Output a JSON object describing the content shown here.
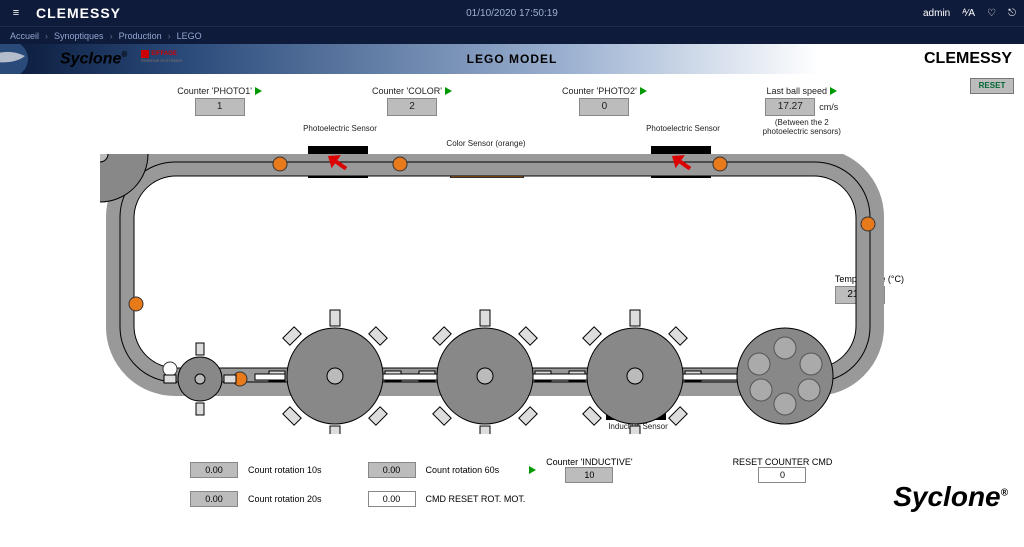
{
  "topbar": {
    "brand": "CLEMESSY",
    "datetime": "01/10/2020 17:50:19",
    "user": "admin"
  },
  "breadcrumbs": [
    "Accueil",
    "Synoptiques",
    "Production",
    "LEGO"
  ],
  "header": {
    "syclone": "Syclone",
    "eiffage": "EIFFAGE",
    "eiffage_sub": "ÉNERGIE SYSTÈMES",
    "title": "LEGO  MODEL",
    "brandright": "CLEMESSY",
    "reset": "RESET"
  },
  "counters": {
    "photo1": {
      "label": "Counter 'PHOTO1'",
      "value": "1",
      "sub": "Photoelectric Sensor"
    },
    "color": {
      "label": "Counter 'COLOR'",
      "value": "2",
      "sub": "Color Sensor (orange)"
    },
    "photo2": {
      "label": "Counter 'PHOTO2'",
      "value": "0",
      "sub": "Photoelectric Sensor"
    },
    "speed": {
      "label": "Last ball speed",
      "value": "17.27",
      "unit": "cm/s",
      "sub": "(Between the 2 photoelectric sensors)"
    }
  },
  "temperature": {
    "label": "Temperature (°C)",
    "value": "21.70"
  },
  "inductive": {
    "label": "Inductive Sensor",
    "counter_label": "Counter 'INDUCTIVE'",
    "value": "10"
  },
  "rotation": {
    "r10": {
      "label": "Count rotation 10s",
      "value": "0.00"
    },
    "r20": {
      "label": "Count rotation 20s",
      "value": "0.00"
    },
    "r60": {
      "label": "Count rotation 60s",
      "value": "0.00"
    },
    "cmd_reset_label": "CMD RESET ROT. MOT.",
    "cmd_reset_value": "0.00"
  },
  "reset_counter": {
    "label": "RESET COUNTER CMD",
    "value": "0"
  },
  "bottom_brand": "Syclone"
}
